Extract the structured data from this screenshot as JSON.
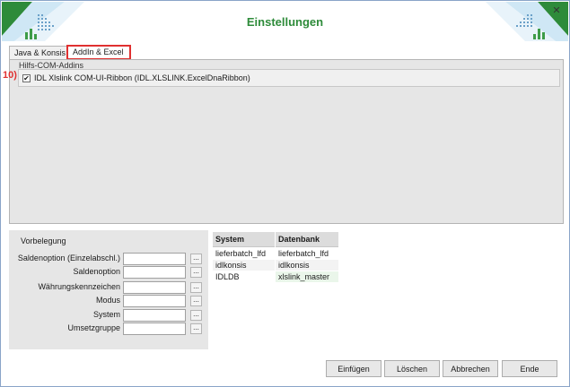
{
  "window": {
    "title": "Einstellungen",
    "close_glyph": "✕",
    "accent_color": "#2e8b3a"
  },
  "tabs": [
    {
      "label": "Java & Konsis",
      "selected": false
    },
    {
      "label": "AddIn & Excel",
      "selected": true
    }
  ],
  "addins": {
    "group_title": "Hilfs-COM-Addins",
    "step_marker": "10)",
    "items": [
      {
        "label": "IDL Xlslink COM-UI-Ribbon (IDL.XLSLINK.ExcelDnaRibbon)",
        "checked": true
      }
    ]
  },
  "vorbelegung": {
    "title": "Vorbelegung",
    "browse_label": "...",
    "fields": [
      {
        "label": "Saldenoption (Einzelabschl.)",
        "value": ""
      },
      {
        "label": "Saldenoption",
        "value": ""
      },
      {
        "label": "Währungskennzeichen",
        "value": ""
      },
      {
        "label": "Modus",
        "value": ""
      },
      {
        "label": "System",
        "value": ""
      },
      {
        "label": "Umsetzgruppe",
        "value": ""
      }
    ]
  },
  "db_table": {
    "headers": [
      "System",
      "Datenbank"
    ],
    "rows": [
      [
        "lieferbatch_lfd",
        "lieferbatch_lfd"
      ],
      [
        "idlkonsis",
        "idlkonsis"
      ],
      [
        "IDLDB",
        "xlslink_master"
      ]
    ]
  },
  "footer": {
    "insert_label": "Einfügen",
    "delete_label": "Löschen",
    "cancel_label": "Abbrechen",
    "end_label": "Ende"
  }
}
